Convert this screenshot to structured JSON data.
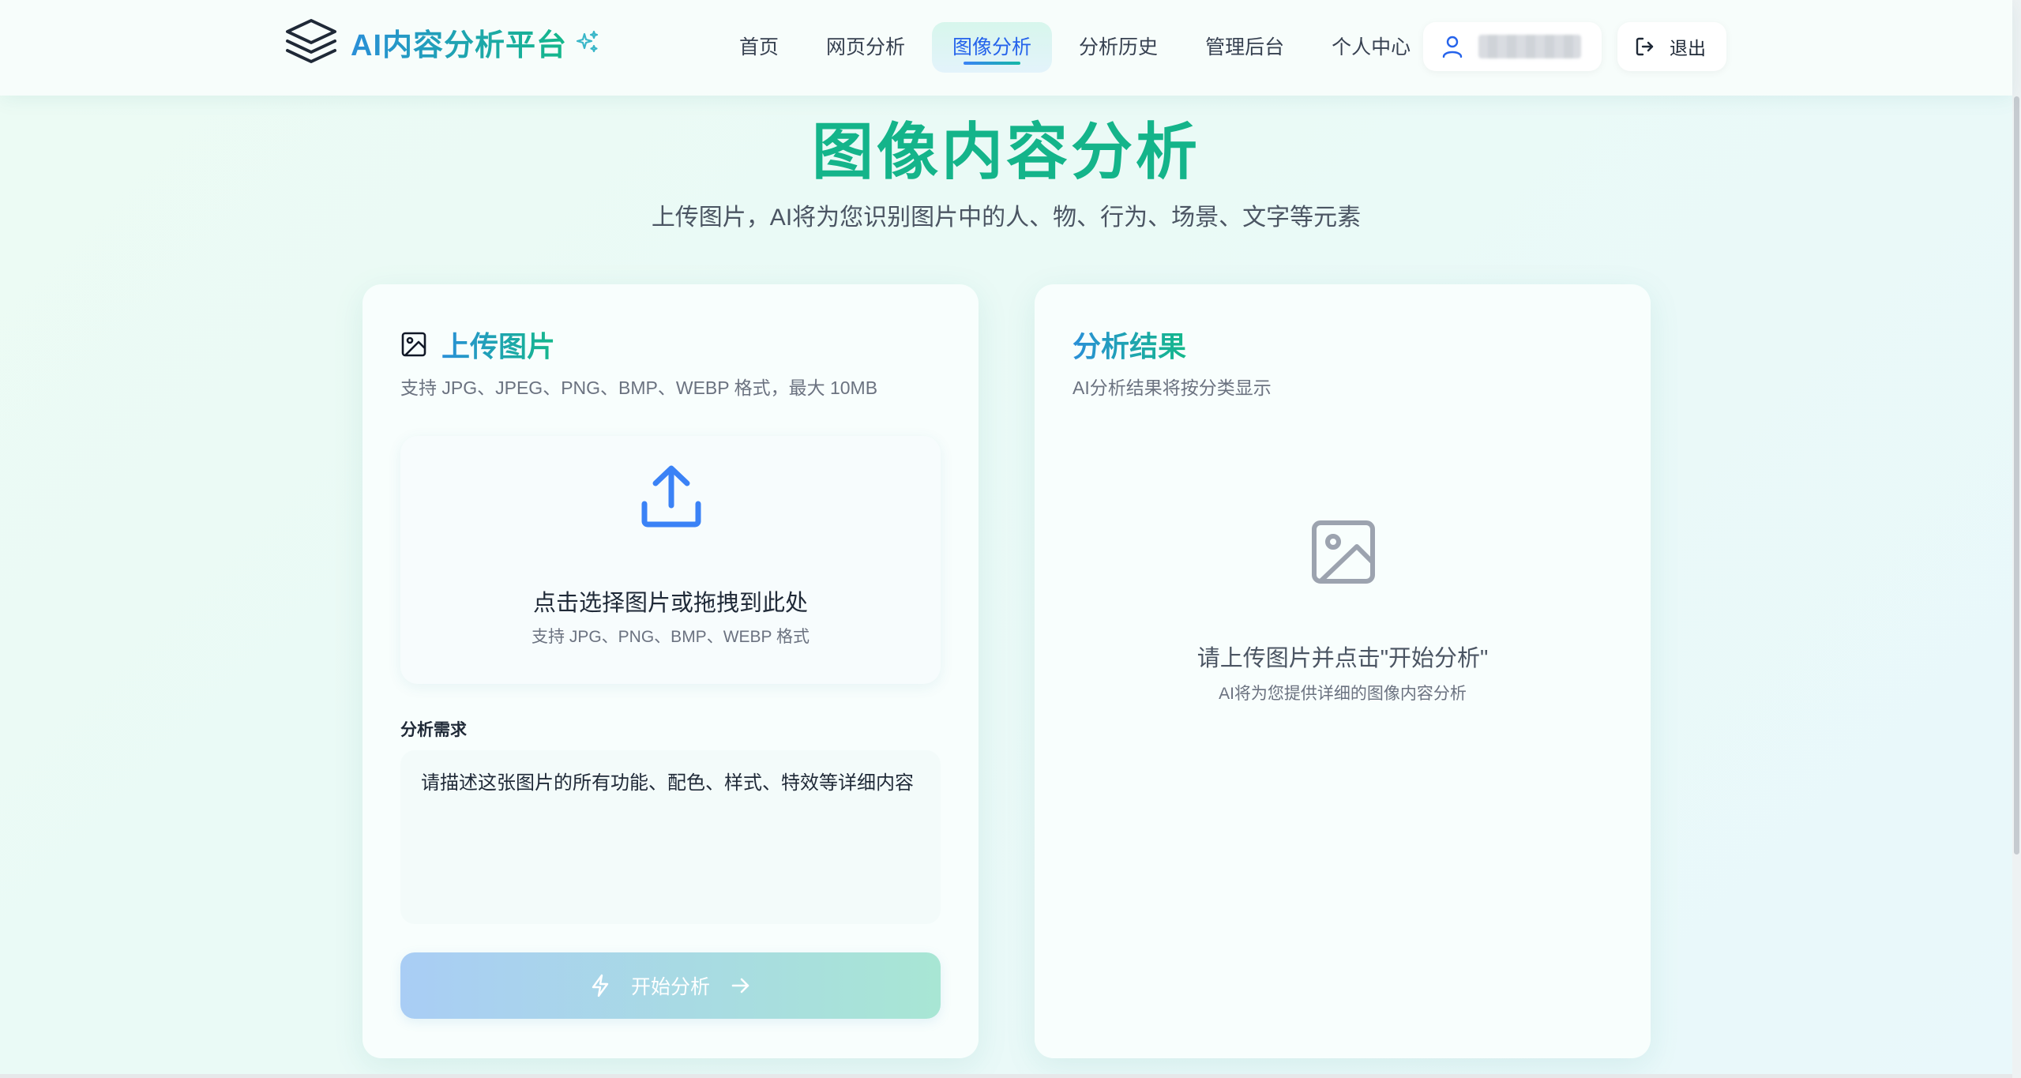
{
  "header": {
    "logo_text": "AI内容分析平台",
    "nav": [
      {
        "label": "首页",
        "active": false
      },
      {
        "label": "网页分析",
        "active": false
      },
      {
        "label": "图像分析",
        "active": true
      },
      {
        "label": "分析历史",
        "active": false
      },
      {
        "label": "管理后台",
        "active": false
      },
      {
        "label": "个人中心",
        "active": false
      }
    ],
    "user_name": "blurred-username",
    "logout_label": "退出"
  },
  "hero": {
    "title": "图像内容分析",
    "subtitle": "上传图片，AI将为您识别图片中的人、物、行为、场景、文字等元素"
  },
  "upload_card": {
    "title": "上传图片",
    "desc": "支持 JPG、JPEG、PNG、BMP、WEBP 格式，最大 10MB",
    "dropzone_main": "点击选择图片或拖拽到此处",
    "dropzone_sub": "支持 JPG、PNG、BMP、WEBP 格式",
    "requirement_label": "分析需求",
    "requirement_value": "请描述这张图片的所有功能、配色、样式、特效等详细内容",
    "start_label": "开始分析"
  },
  "result_card": {
    "title": "分析结果",
    "desc": "AI分析结果将按分类显示",
    "empty_main": "请上传图片并点击\"开始分析\"",
    "empty_sub": "AI将为您提供详细的图像内容分析"
  },
  "colors": {
    "accent_green": "#14b48a",
    "accent_blue": "#2563eb",
    "icon_blue": "#3b82f6",
    "muted_gray": "#9ca3af"
  },
  "icons": [
    "layers-icon",
    "sparkle-icon",
    "user-icon",
    "logout-icon",
    "image-icon",
    "upload-icon",
    "lightning-icon",
    "arrow-right-icon"
  ]
}
